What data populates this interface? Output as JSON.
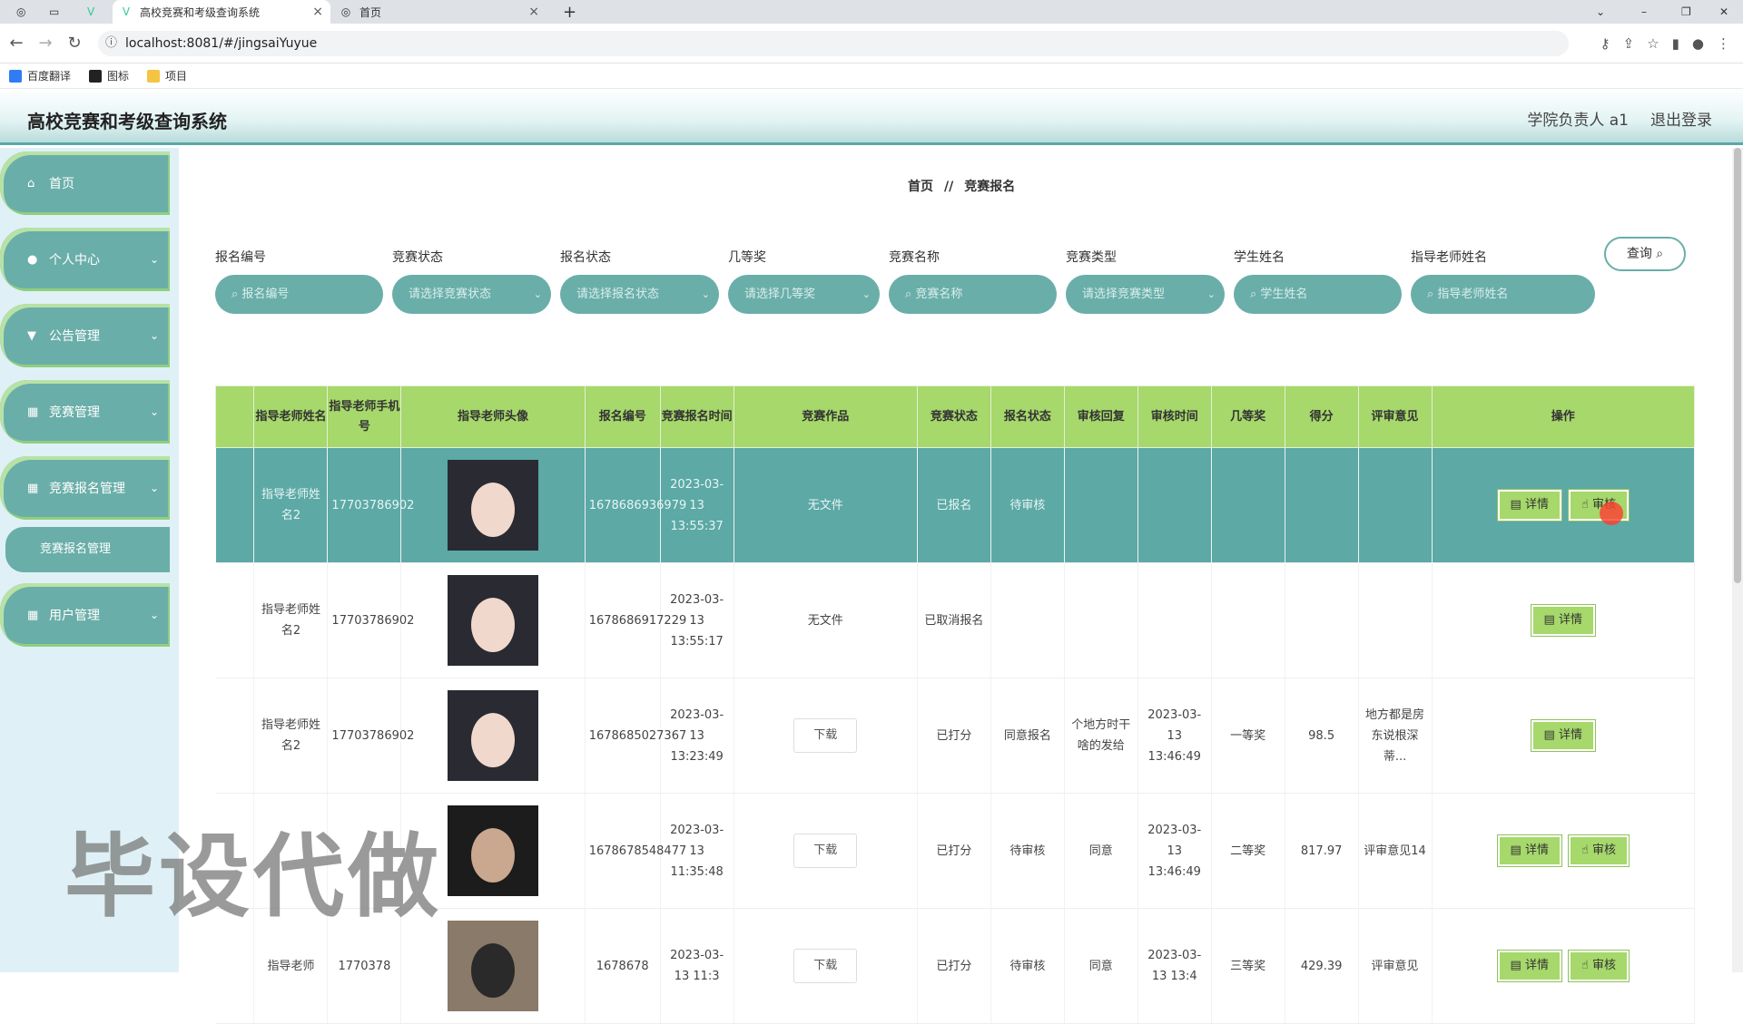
{
  "browser": {
    "tabs": [
      {
        "title": "高校竞赛和考级查询系统",
        "active": true
      },
      {
        "title": "首页",
        "active": false
      }
    ],
    "url": "localhost:8081/#/jingsaiYuyue",
    "bookmarks": [
      "百度翻译",
      "图标",
      "项目"
    ]
  },
  "header": {
    "title": "高校竞赛和考级查询系统",
    "user": "学院负责人 a1",
    "logout": "退出登录"
  },
  "sidebar": {
    "items": [
      {
        "label": "首页",
        "icon": "home-icon"
      },
      {
        "label": "个人中心",
        "icon": "user-icon"
      },
      {
        "label": "公告管理",
        "icon": "notice-icon"
      },
      {
        "label": "竞赛管理",
        "icon": "grid-icon"
      },
      {
        "label": "竞赛报名管理",
        "icon": "grid-icon"
      },
      {
        "label": "用户管理",
        "icon": "grid-icon"
      }
    ],
    "submenu": "竞赛报名管理"
  },
  "breadcrumb": {
    "home": "首页",
    "sep": "//",
    "current": "竞赛报名"
  },
  "filters": [
    {
      "label": "报名编号",
      "placeholder": "报名编号",
      "type": "search"
    },
    {
      "label": "竞赛状态",
      "placeholder": "请选择竞赛状态",
      "type": "select"
    },
    {
      "label": "报名状态",
      "placeholder": "请选择报名状态",
      "type": "select"
    },
    {
      "label": "几等奖",
      "placeholder": "请选择几等奖",
      "type": "select"
    },
    {
      "label": "竞赛名称",
      "placeholder": "竞赛名称",
      "type": "search"
    },
    {
      "label": "竞赛类型",
      "placeholder": "请选择竞赛类型",
      "type": "select"
    },
    {
      "label": "学生姓名",
      "placeholder": "学生姓名",
      "type": "search"
    },
    {
      "label": "指导老师姓名",
      "placeholder": "指导老师姓名",
      "type": "search"
    }
  ],
  "query_label": "查询",
  "table": {
    "columns": [
      "",
      "指导老师姓名",
      "指导老师手机号",
      "指导老师头像",
      "报名编号",
      "竞赛报名时间",
      "竞赛作品",
      "竞赛状态",
      "报名状态",
      "审核回复",
      "审核时间",
      "几等奖",
      "得分",
      "评审意见",
      "操作"
    ],
    "rows": [
      {
        "name": "指导老师姓名2",
        "phone": "17703786902",
        "code": "1678686936979",
        "time": "2023-03-13 13:55:37",
        "work": "无文件",
        "comp_status": "已报名",
        "reg_status": "待审核",
        "reply": "",
        "audit_time": "",
        "prize": "",
        "score": "",
        "comment": "",
        "actions": [
          "详情",
          "审核"
        ]
      },
      {
        "name": "指导老师姓名2",
        "phone": "17703786902",
        "code": "1678686917229",
        "time": "2023-03-13 13:55:17",
        "work": "无文件",
        "comp_status": "已取消报名",
        "reg_status": "",
        "reply": "",
        "audit_time": "",
        "prize": "",
        "score": "",
        "comment": "",
        "actions": [
          "详情"
        ]
      },
      {
        "name": "指导老师姓名2",
        "phone": "17703786902",
        "code": "1678685027367",
        "time": "2023-03-13 13:23:49",
        "work": "下载",
        "comp_status": "已打分",
        "reg_status": "同意报名",
        "reply": "个地方时干啥的发给",
        "audit_time": "2023-03-13 13:46:49",
        "prize": "一等奖",
        "score": "98.5",
        "comment": "地方都是房东说根深蒂...",
        "actions": [
          "详情"
        ]
      },
      {
        "name": "",
        "phone": "",
        "code": "1678678548477",
        "time": "2023-03-13 11:35:48",
        "work": "下载",
        "comp_status": "已打分",
        "reg_status": "待审核",
        "reply": "同意",
        "audit_time": "2023-03-13 13:46:49",
        "prize": "二等奖",
        "score": "817.97",
        "comment": "评审意见14",
        "actions": [
          "详情",
          "审核"
        ]
      },
      {
        "name": "指导老师",
        "phone": "1770378",
        "code": "1678678",
        "time": "2023-03-13 11:3",
        "work": "下载",
        "comp_status": "已打分",
        "reg_status": "待审核",
        "reply": "同意",
        "audit_time": "2023-03-13 13:4",
        "prize": "三等奖",
        "score": "429.39",
        "comment": "评审意见",
        "actions": [
          "详情",
          "审核"
        ]
      }
    ]
  },
  "watermark": "毕设代做",
  "colors": {
    "teal": "#6aaea9",
    "green": "#a6d86b",
    "highlight": "#5ca9a6"
  }
}
